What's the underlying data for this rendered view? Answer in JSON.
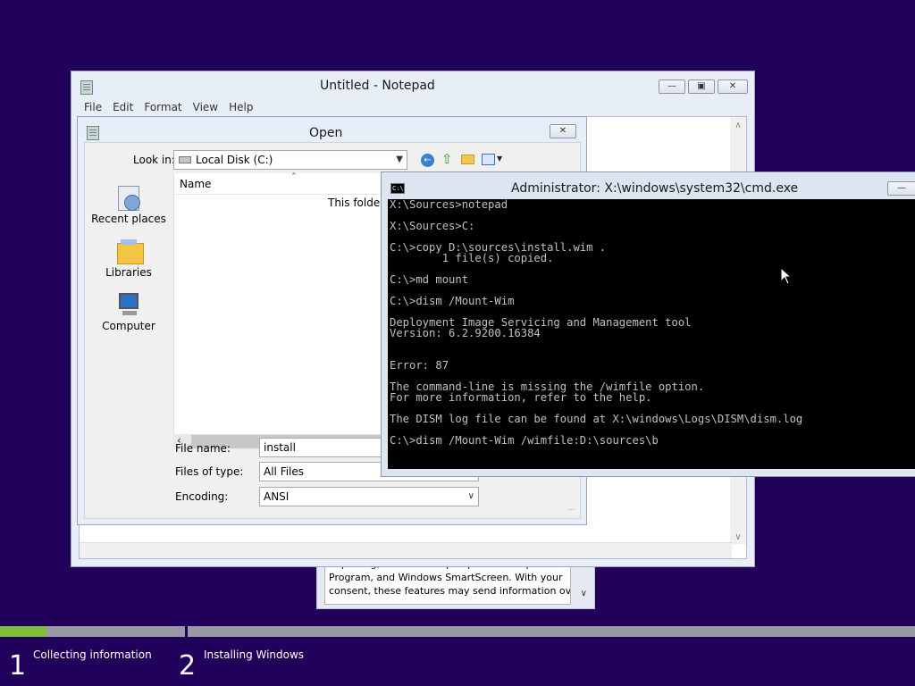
{
  "eula": {
    "lines": [
      "Reporting, Windows Help Experience Improvement",
      "Program, and Windows SmartScreen. With your",
      "consent, these features may send information over"
    ]
  },
  "notepad": {
    "title": "Untitled - Notepad",
    "menu": [
      "File",
      "Edit",
      "Format",
      "View",
      "Help"
    ]
  },
  "open_dialog": {
    "title": "Open",
    "look_in_label": "Look in:",
    "look_in_value": "Local Disk (C:)",
    "places": [
      "Recent places",
      "Libraries",
      "Computer"
    ],
    "column_name": "Name",
    "empty_text": "This folder i",
    "file_name_label": "File name:",
    "file_name_value": "install",
    "files_of_type_label": "Files of type:",
    "files_of_type_value": "All Files",
    "encoding_label": "Encoding:",
    "encoding_value": "ANSI"
  },
  "cmd": {
    "title": "Administrator: X:\\windows\\system32\\cmd.exe",
    "icon_text": "C:\\",
    "lines": [
      "X:\\Sources>notepad",
      "",
      "X:\\Sources>C:",
      "",
      "C:\\>copy D:\\sources\\install.wim .",
      "        1 file(s) copied.",
      "",
      "C:\\>md mount",
      "",
      "C:\\>dism /Mount-Wim",
      "",
      "Deployment Image Servicing and Management tool",
      "Version: 6.2.9200.16384",
      "",
      "",
      "Error: 87",
      "",
      "The command-line is missing the /wimfile option.",
      "For more information, refer to the help.",
      "",
      "The DISM log file can be found at X:\\windows\\Logs\\DISM\\dism.log",
      "",
      "C:\\>dism /Mount-Wim /wimfile:D:\\sources\\b"
    ]
  },
  "setup": {
    "steps": [
      {
        "number": "1",
        "label": "Collecting information",
        "progress": 0.25
      },
      {
        "number": "2",
        "label": "Installing Windows",
        "progress": 0
      }
    ]
  },
  "colors": {
    "background": "#21005b",
    "progress_fill": "#7fbf33",
    "progress_track": "#9a9aa6"
  }
}
